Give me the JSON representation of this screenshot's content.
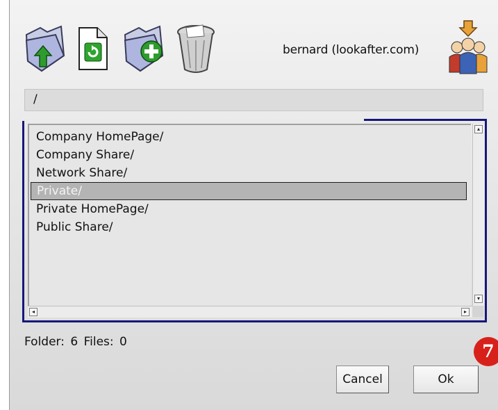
{
  "toolbar": {
    "icons": [
      "folder-up-icon",
      "refresh-file-icon",
      "new-folder-icon",
      "trash-icon"
    ]
  },
  "user": {
    "label": "bernard (lookafter.com)",
    "icon": "users-icon"
  },
  "path": {
    "value": "/"
  },
  "files": {
    "items": [
      "Company HomePage/",
      "Company Share/",
      "Network Share/",
      "Private/",
      "Private HomePage/",
      "Public Share/"
    ],
    "selected_index": 3
  },
  "status": {
    "text": "Folder: 6  Files: 0"
  },
  "buttons": {
    "cancel": "Cancel",
    "ok": "Ok"
  },
  "annotation": {
    "badge": "7",
    "color": "#d8201b"
  },
  "colors": {
    "focus_border": "#17177a",
    "selection": "#b4b4b4"
  }
}
